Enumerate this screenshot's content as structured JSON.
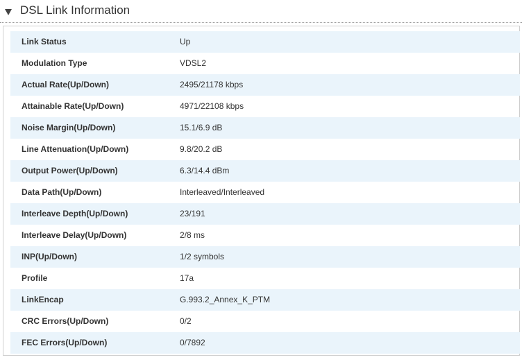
{
  "section": {
    "title": "DSL Link Information",
    "toggle_icon": "triangle-down-icon"
  },
  "rows": [
    {
      "label": "Link Status",
      "value": "Up"
    },
    {
      "label": "Modulation Type",
      "value": "VDSL2"
    },
    {
      "label": "Actual Rate(Up/Down)",
      "value": "2495/21178 kbps"
    },
    {
      "label": "Attainable Rate(Up/Down)",
      "value": "4971/22108 kbps"
    },
    {
      "label": "Noise Margin(Up/Down)",
      "value": "15.1/6.9 dB"
    },
    {
      "label": "Line Attenuation(Up/Down)",
      "value": "9.8/20.2 dB"
    },
    {
      "label": "Output Power(Up/Down)",
      "value": "6.3/14.4 dBm"
    },
    {
      "label": "Data Path(Up/Down)",
      "value": "Interleaved/Interleaved"
    },
    {
      "label": "Interleave Depth(Up/Down)",
      "value": "23/191"
    },
    {
      "label": "Interleave Delay(Up/Down)",
      "value": "2/8 ms"
    },
    {
      "label": "INP(Up/Down)",
      "value": "1/2 symbols"
    },
    {
      "label": "Profile",
      "value": "17a"
    },
    {
      "label": "LinkEncap",
      "value": "G.993.2_Annex_K_PTM"
    },
    {
      "label": "CRC Errors(Up/Down)",
      "value": "0/2"
    },
    {
      "label": "FEC Errors(Up/Down)",
      "value": "0/7892"
    }
  ],
  "colors": {
    "row_shade": "#eaf4fb",
    "text": "#333333",
    "border": "#cfcfcf"
  }
}
